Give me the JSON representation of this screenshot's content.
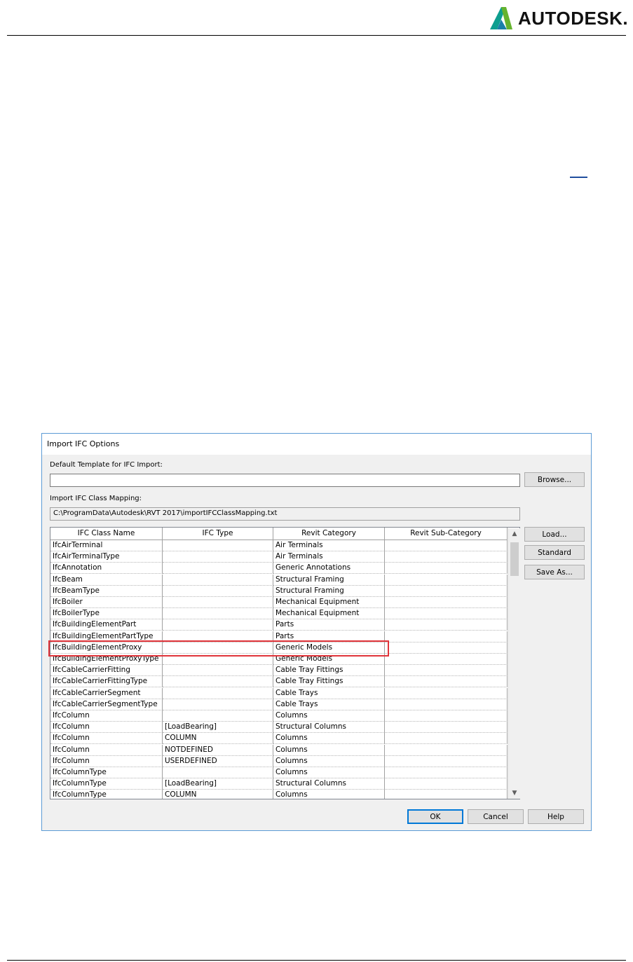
{
  "header": {
    "brand": "AUTODESK."
  },
  "dialog": {
    "title": "Import IFC Options",
    "template_label": "Default Template for IFC Import:",
    "template_value": "",
    "browse": "Browse...",
    "mapping_label": "Import IFC Class Mapping:",
    "mapping_path": "C:\\ProgramData\\Autodesk\\RVT 2017\\importIFCClassMapping.txt",
    "load": "Load...",
    "standard": "Standard",
    "save_as": "Save As...",
    "ok": "OK",
    "cancel": "Cancel",
    "help": "Help",
    "columns": [
      "IFC Class Name",
      "IFC Type",
      "Revit Category",
      "Revit Sub-Category"
    ],
    "rows": [
      [
        "IfcAirTerminal",
        "",
        "Air Terminals",
        ""
      ],
      [
        "IfcAirTerminalType",
        "",
        "Air Terminals",
        ""
      ],
      [
        "IfcAnnotation",
        "",
        "Generic Annotations",
        ""
      ],
      [
        "IfcBeam",
        "",
        "Structural Framing",
        ""
      ],
      [
        "IfcBeamType",
        "",
        "Structural Framing",
        ""
      ],
      [
        "IfcBoiler",
        "",
        "Mechanical Equipment",
        ""
      ],
      [
        "IfcBoilerType",
        "",
        "Mechanical Equipment",
        ""
      ],
      [
        "IfcBuildingElementPart",
        "",
        "Parts",
        ""
      ],
      [
        "IfcBuildingElementPartType",
        "",
        "Parts",
        ""
      ],
      [
        "IfcBuildingElementProxy",
        "",
        "Generic Models",
        ""
      ],
      [
        "IfcBuildingElementProxyType",
        "",
        "Generic Models",
        ""
      ],
      [
        "IfcCableCarrierFitting",
        "",
        "Cable Tray Fittings",
        ""
      ],
      [
        "IfcCableCarrierFittingType",
        "",
        "Cable Tray Fittings",
        ""
      ],
      [
        "IfcCableCarrierSegment",
        "",
        "Cable Trays",
        ""
      ],
      [
        "IfcCableCarrierSegmentType",
        "",
        "Cable Trays",
        ""
      ],
      [
        "IfcColumn",
        "",
        "Columns",
        ""
      ],
      [
        "IfcColumn",
        "[LoadBearing]",
        "Structural Columns",
        ""
      ],
      [
        "IfcColumn",
        "COLUMN",
        "Columns",
        ""
      ],
      [
        "IfcColumn",
        "NOTDEFINED",
        "Columns",
        ""
      ],
      [
        "IfcColumn",
        "USERDEFINED",
        "Columns",
        ""
      ],
      [
        "IfcColumnType",
        "",
        "Columns",
        ""
      ],
      [
        "IfcColumnType",
        "[LoadBearing]",
        "Structural Columns",
        ""
      ],
      [
        "IfcColumnType",
        "COLUMN",
        "Columns",
        ""
      ]
    ],
    "highlight_color": "#e0343a",
    "accent_color": "#0078d7"
  }
}
